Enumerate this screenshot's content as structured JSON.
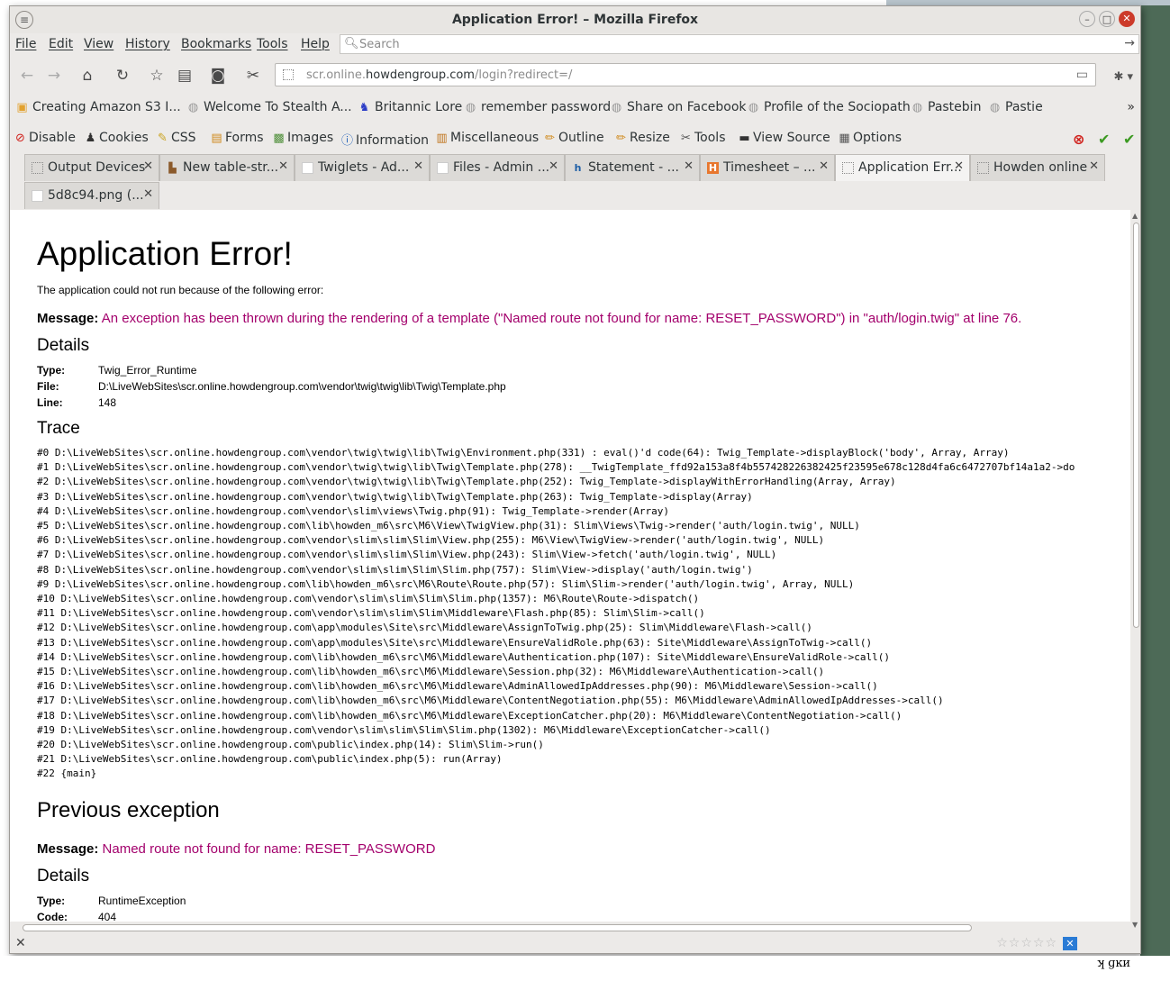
{
  "window": {
    "title": "Application Error! – Mozilla Firefox"
  },
  "menubar": {
    "items": [
      "File",
      "Edit",
      "View",
      "History",
      "Bookmarks",
      "Tools",
      "Help"
    ],
    "search_placeholder": "Search"
  },
  "nav": {
    "url_prefix": "scr.online.",
    "url_host": "howdengroup.com",
    "url_path": "/login?redirect=/"
  },
  "bookmarks": [
    "Creating Amazon S3 I...",
    "Welcome To Stealth A...",
    "Britannic Lore",
    "remember password",
    "Share on Facebook",
    "Profile of the Sociopath",
    "Pastebin",
    "Pastie"
  ],
  "devtoolbar": [
    "Disable",
    "Cookies",
    "CSS",
    "Forms",
    "Images",
    "Information",
    "Miscellaneous",
    "Outline",
    "Resize",
    "Tools",
    "View Source",
    "Options"
  ],
  "tabs": [
    "Output Devices",
    "New table-str...",
    "Twiglets - Ad...",
    "Files - Admin ...",
    "Statement - ...",
    "Timesheet – ...",
    "Application Err...",
    "Howden online",
    "5d8c94.png (..."
  ],
  "page": {
    "title": "Application Error!",
    "intro": "The application could not run because of the following error:",
    "message_label": "Message:",
    "message": "An exception has been thrown during the rendering of a template (\"Named route not found for name: RESET_PASSWORD\") in \"auth/login.twig\" at line 76.",
    "details_heading": "Details",
    "type_label": "Type:",
    "type": "Twig_Error_Runtime",
    "file_label": "File:",
    "file": "D:\\LiveWebSites\\scr.online.howdengroup.com\\vendor\\twig\\twig\\lib\\Twig\\Template.php",
    "line_label": "Line:",
    "line": "148",
    "trace_heading": "Trace",
    "trace": [
      "#0 D:\\LiveWebSites\\scr.online.howdengroup.com\\vendor\\twig\\twig\\lib\\Twig\\Environment.php(331) : eval()'d code(64): Twig_Template->displayBlock('body', Array, Array)",
      "#1 D:\\LiveWebSites\\scr.online.howdengroup.com\\vendor\\twig\\twig\\lib\\Twig\\Template.php(278): __TwigTemplate_ffd92a153a8f4b557428226382425f23595e678c128d4fa6c6472707bf14a1a2->do",
      "#2 D:\\LiveWebSites\\scr.online.howdengroup.com\\vendor\\twig\\twig\\lib\\Twig\\Template.php(252): Twig_Template->displayWithErrorHandling(Array, Array)",
      "#3 D:\\LiveWebSites\\scr.online.howdengroup.com\\vendor\\twig\\twig\\lib\\Twig\\Template.php(263): Twig_Template->display(Array)",
      "#4 D:\\LiveWebSites\\scr.online.howdengroup.com\\vendor\\slim\\views\\Twig.php(91): Twig_Template->render(Array)",
      "#5 D:\\LiveWebSites\\scr.online.howdengroup.com\\lib\\howden_m6\\src\\M6\\View\\TwigView.php(31): Slim\\Views\\Twig->render('auth/login.twig', NULL)",
      "#6 D:\\LiveWebSites\\scr.online.howdengroup.com\\vendor\\slim\\slim\\Slim\\View.php(255): M6\\View\\TwigView->render('auth/login.twig', NULL)",
      "#7 D:\\LiveWebSites\\scr.online.howdengroup.com\\vendor\\slim\\slim\\Slim\\View.php(243): Slim\\View->fetch('auth/login.twig', NULL)",
      "#8 D:\\LiveWebSites\\scr.online.howdengroup.com\\vendor\\slim\\slim\\Slim\\Slim.php(757): Slim\\View->display('auth/login.twig')",
      "#9 D:\\LiveWebSites\\scr.online.howdengroup.com\\lib\\howden_m6\\src\\M6\\Route\\Route.php(57): Slim\\Slim->render('auth/login.twig', Array, NULL)",
      "#10 D:\\LiveWebSites\\scr.online.howdengroup.com\\vendor\\slim\\slim\\Slim\\Slim.php(1357): M6\\Route\\Route->dispatch()",
      "#11 D:\\LiveWebSites\\scr.online.howdengroup.com\\vendor\\slim\\slim\\Slim\\Middleware\\Flash.php(85): Slim\\Slim->call()",
      "#12 D:\\LiveWebSites\\scr.online.howdengroup.com\\app\\modules\\Site\\src\\Middleware\\AssignToTwig.php(25): Slim\\Middleware\\Flash->call()",
      "#13 D:\\LiveWebSites\\scr.online.howdengroup.com\\app\\modules\\Site\\src\\Middleware\\EnsureValidRole.php(63): Site\\Middleware\\AssignToTwig->call()",
      "#14 D:\\LiveWebSites\\scr.online.howdengroup.com\\lib\\howden_m6\\src\\M6\\Middleware\\Authentication.php(107): Site\\Middleware\\EnsureValidRole->call()",
      "#15 D:\\LiveWebSites\\scr.online.howdengroup.com\\lib\\howden_m6\\src\\M6\\Middleware\\Session.php(32): M6\\Middleware\\Authentication->call()",
      "#16 D:\\LiveWebSites\\scr.online.howdengroup.com\\lib\\howden_m6\\src\\M6\\Middleware\\AdminAllowedIpAddresses.php(90): M6\\Middleware\\Session->call()",
      "#17 D:\\LiveWebSites\\scr.online.howdengroup.com\\lib\\howden_m6\\src\\M6\\Middleware\\ContentNegotiation.php(55): M6\\Middleware\\AdminAllowedIpAddresses->call()",
      "#18 D:\\LiveWebSites\\scr.online.howdengroup.com\\lib\\howden_m6\\src\\M6\\Middleware\\ExceptionCatcher.php(20): M6\\Middleware\\ContentNegotiation->call()",
      "#19 D:\\LiveWebSites\\scr.online.howdengroup.com\\vendor\\slim\\slim\\Slim\\Slim.php(1302): M6\\Middleware\\ExceptionCatcher->call()",
      "#20 D:\\LiveWebSites\\scr.online.howdengroup.com\\public\\index.php(14): Slim\\Slim->run()",
      "#21 D:\\LiveWebSites\\scr.online.howdengroup.com\\public\\index.php(5): run(Array)",
      "#22 {main}"
    ],
    "prev_heading": "Previous exception",
    "prev_message_label": "Message:",
    "prev_message": "Named route not found for name: RESET_PASSWORD",
    "prev_details_heading": "Details",
    "prev_type_label": "Type:",
    "prev_type": "RuntimeException",
    "prev_code_label": "Code:",
    "prev_code": "404"
  },
  "status": {
    "addon_label": "ʞ ɡĸи"
  },
  "colors": {
    "error_message": "#a3006c",
    "close_button": "#cc3b2a"
  }
}
